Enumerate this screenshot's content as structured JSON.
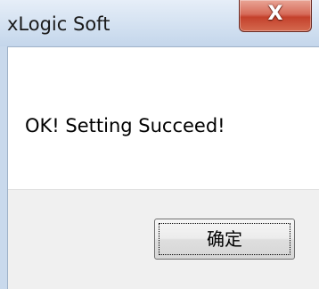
{
  "window": {
    "title": "xLogic Soft",
    "close_icon": "close-icon",
    "close_glyph": "X"
  },
  "dialog": {
    "message": "OK! Setting Succeed!",
    "ok_label": "确定"
  },
  "colors": {
    "close_button": "#c4412c",
    "button_band": "#f0f0f0",
    "titlebar": "#d3e1f1"
  }
}
